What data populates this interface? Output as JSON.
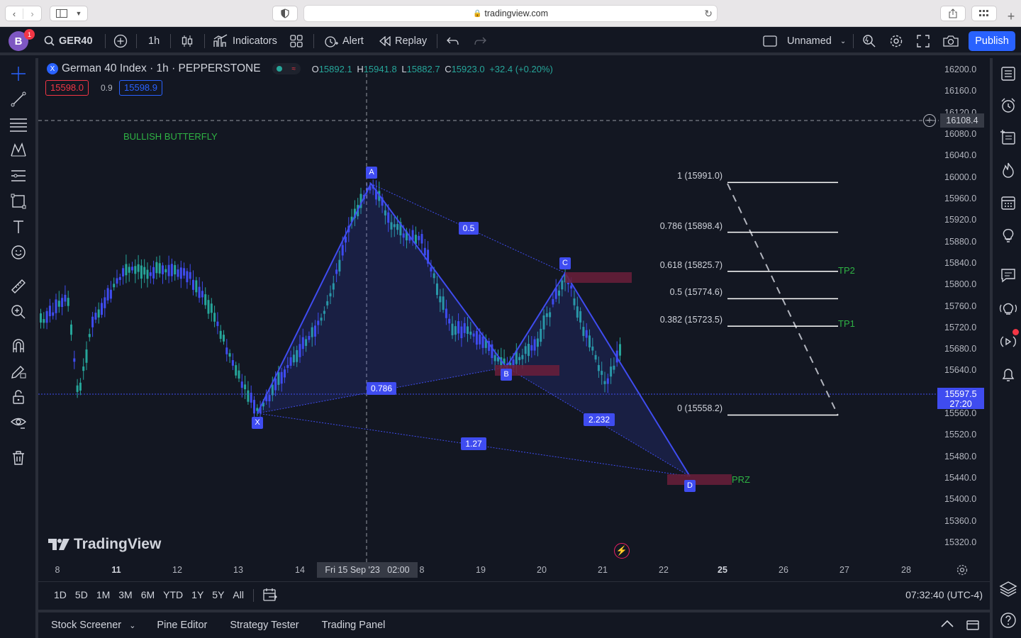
{
  "browser": {
    "url": "tradingview.com"
  },
  "toolbar": {
    "avatar_letter": "B",
    "avatar_badge": "1",
    "symbol": "GER40",
    "interval": "1h",
    "indicators": "Indicators",
    "alert": "Alert",
    "replay": "Replay",
    "layout_name": "Unnamed",
    "publish": "Publish"
  },
  "legend": {
    "title": "German 40 Index · 1h · PEPPERSTONE",
    "o_label": "O",
    "o": "15892.1",
    "h_label": "H",
    "h": "15941.8",
    "l_label": "L",
    "l": "15882.7",
    "c_label": "C",
    "c": "15923.0",
    "change": "+32.4 (+0.20%)",
    "bid": "15598.0",
    "spread": "0.9",
    "ask": "15598.9"
  },
  "chart": {
    "pattern_title": "BULLISH BUTTERFLY",
    "points": {
      "X": "X",
      "A": "A",
      "B": "B",
      "C": "C",
      "D": "D"
    },
    "ratios": {
      "xb": "0.786",
      "ac": "0.5",
      "bd": "2.232",
      "xd": "1.27"
    },
    "prz": "PRZ",
    "tp1": "TP1",
    "tp2": "TP2",
    "fib_levels": [
      {
        "label": "1 (15991.0)",
        "value": 15991.0
      },
      {
        "label": "0.786 (15898.4)",
        "value": 15898.4
      },
      {
        "label": "0.618 (15825.7)",
        "value": 15825.7
      },
      {
        "label": "0.5 (15774.6)",
        "value": 15774.6
      },
      {
        "label": "0.382 (15723.5)",
        "value": 15723.5
      },
      {
        "label": "0 (15558.2)",
        "value": 15558.2
      }
    ],
    "watermark": "TradingView",
    "crosshair_price": "16108.4",
    "current_price": "15597.5",
    "countdown": "27:20",
    "crosshair_time": "Fri 15 Sep '23   02:00"
  },
  "price_axis": [
    "16200.0",
    "16160.0",
    "16120.0",
    "16080.0",
    "16040.0",
    "16000.0",
    "15960.0",
    "15920.0",
    "15880.0",
    "15840.0",
    "15800.0",
    "15760.0",
    "15720.0",
    "15680.0",
    "15640.0",
    "15600.0",
    "15560.0",
    "15520.0",
    "15480.0",
    "15440.0",
    "15400.0",
    "15360.0",
    "15320.0"
  ],
  "time_axis": [
    "8",
    "11",
    "12",
    "13",
    "14",
    "8",
    "19",
    "20",
    "21",
    "22",
    "25",
    "26",
    "27",
    "28"
  ],
  "ranges": [
    "1D",
    "5D",
    "1M",
    "3M",
    "6M",
    "YTD",
    "1Y",
    "5Y",
    "All"
  ],
  "clock": "07:32:40 (UTC-4)",
  "panels": [
    "Stock Screener",
    "Pine Editor",
    "Strategy Tester",
    "Trading Panel"
  ],
  "colors": {
    "accent": "#2962ff",
    "pattern": "#3f4cf0",
    "up": "#26a69a",
    "green_text": "#2fb344",
    "prz": "#6b1f3a"
  }
}
